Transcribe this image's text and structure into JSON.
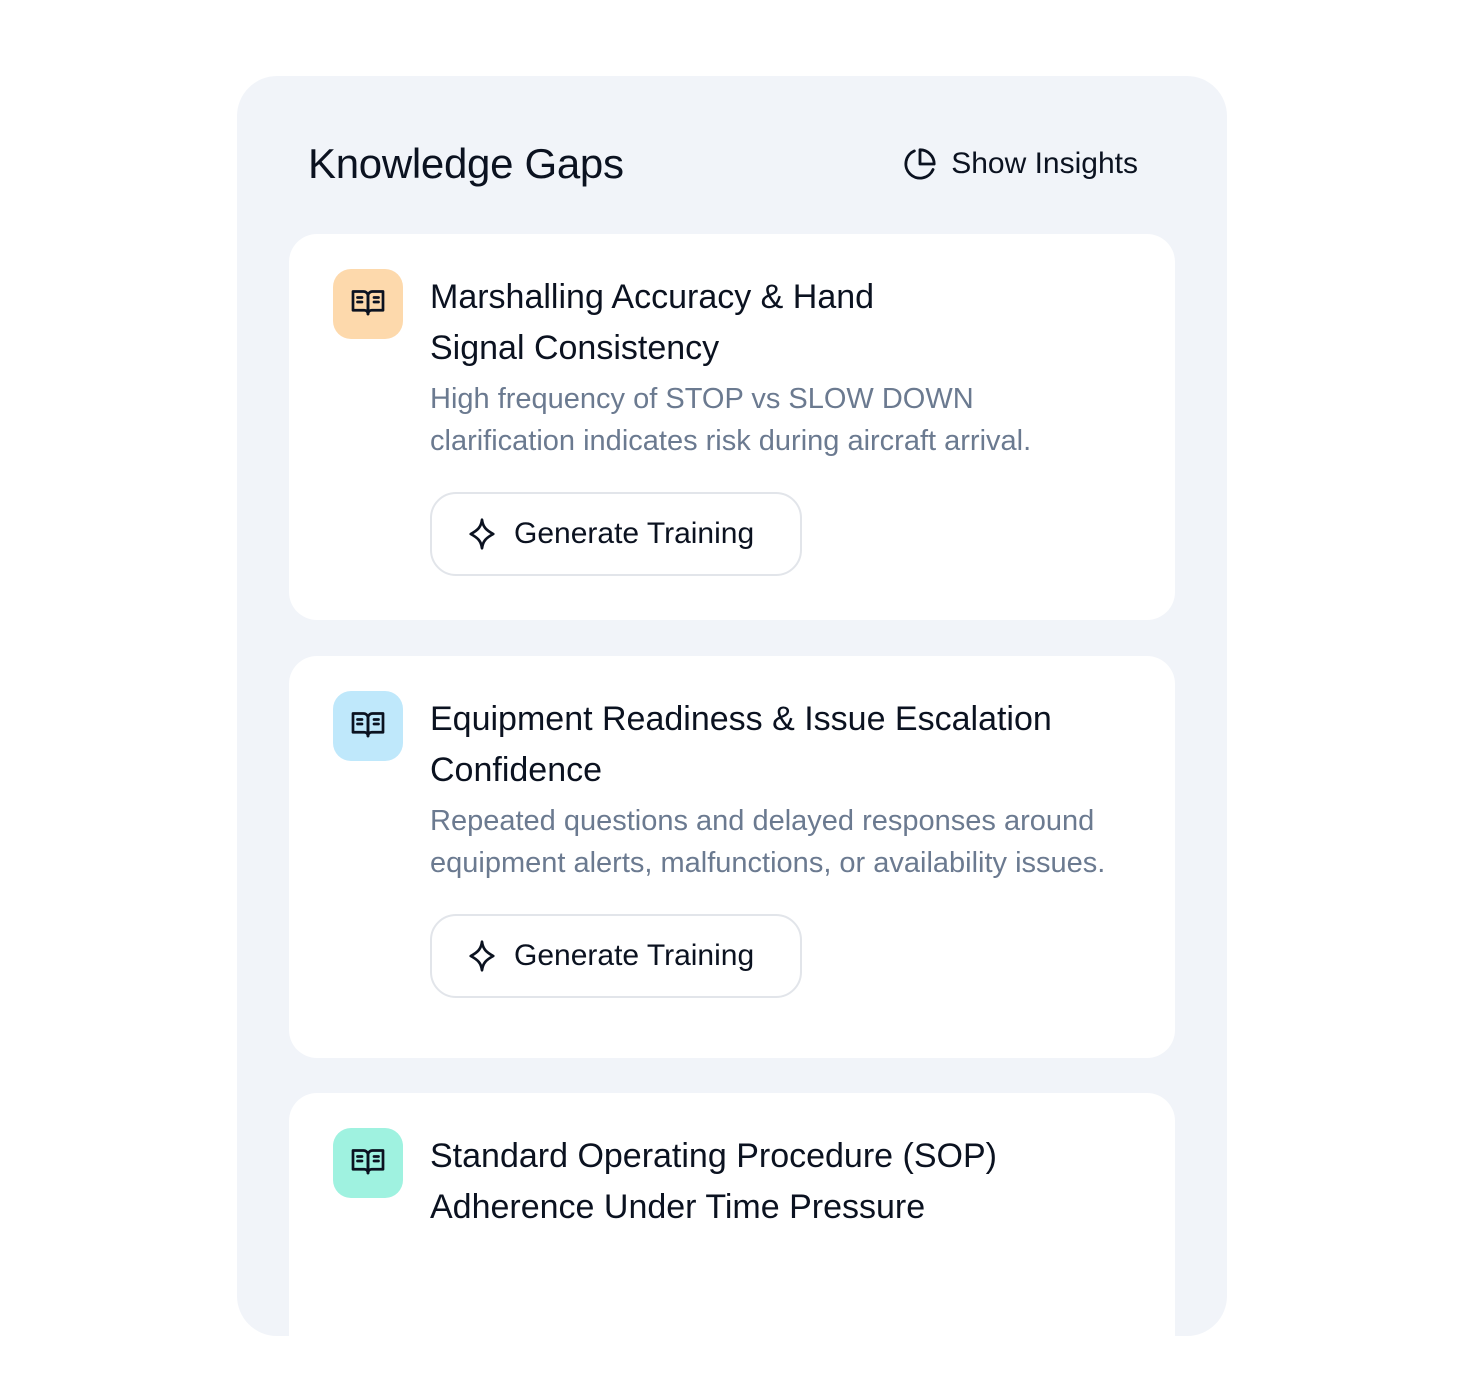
{
  "panel": {
    "title": "Knowledge Gaps",
    "insights_label": "Show Insights"
  },
  "gaps": [
    {
      "title": "Marshalling Accuracy & Hand Signal Consistency",
      "description": "High frequency of STOP vs SLOW DOWN clarification indicates risk during aircraft arrival.",
      "button_label": "Generate Training",
      "icon": "book-open-icon",
      "icon_bg": "#fdd9ac"
    },
    {
      "title": "Equipment Readiness & Issue Escalation Confidence",
      "description": "Repeated questions and delayed responses around equipment alerts, malfunctions, or availability issues.",
      "button_label": "Generate Training",
      "icon": "book-open-icon",
      "icon_bg": "#bfe8fb"
    },
    {
      "title": "Standard Operating Procedure (SOP) Adherence Under Time Pressure",
      "description": "",
      "button_label": "",
      "icon": "book-open-icon",
      "icon_bg": "#9ff2e0"
    }
  ]
}
